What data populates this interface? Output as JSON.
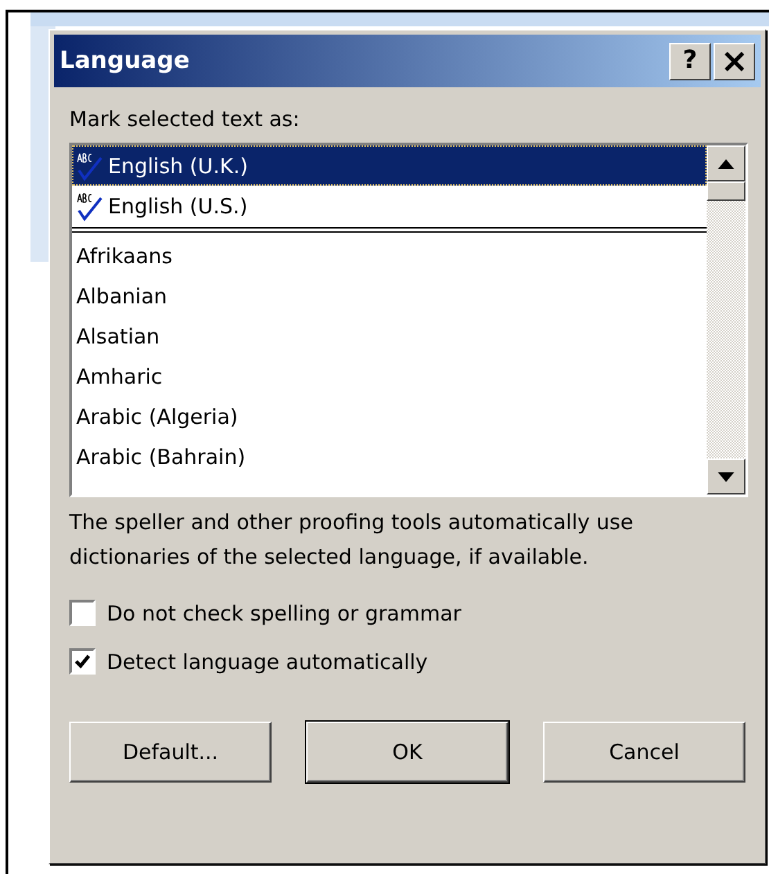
{
  "window": {
    "title": "Language",
    "buttons": [
      {
        "kind": "help",
        "label": "?"
      },
      {
        "kind": "close",
        "label": "×"
      }
    ]
  },
  "list_label": "Mark selected text as:",
  "recent_languages": [
    {
      "label": "English (U.K.)",
      "selected": true,
      "proofing": true
    },
    {
      "label": "English (U.S.)",
      "selected": false,
      "proofing": true
    }
  ],
  "languages": [
    {
      "label": "Afrikaans",
      "selected": false,
      "proofing": false
    },
    {
      "label": "Albanian",
      "selected": false,
      "proofing": false
    },
    {
      "label": "Alsatian",
      "selected": false,
      "proofing": false
    },
    {
      "label": "Amharic",
      "selected": false,
      "proofing": false
    },
    {
      "label": "Arabic (Algeria)",
      "selected": false,
      "proofing": false
    },
    {
      "label": "Arabic (Bahrain)",
      "selected": false,
      "proofing": false
    }
  ],
  "description": "The speller and other proofing tools automatically use dictionaries of the selected language, if available.",
  "options": [
    {
      "label": "Do not check spelling or grammar",
      "checked": false
    },
    {
      "label": "Detect language automatically",
      "checked": true
    }
  ],
  "actions": [
    {
      "label": "Default...",
      "default": false
    },
    {
      "label": "OK",
      "default": true
    },
    {
      "label": "Cancel",
      "default": false
    }
  ]
}
